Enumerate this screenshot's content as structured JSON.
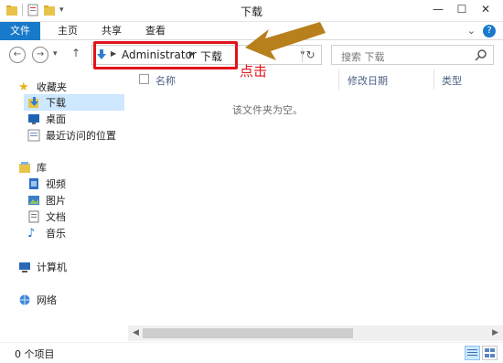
{
  "window": {
    "title": "下载"
  },
  "ribbon": {
    "tabs": [
      "文件",
      "主页",
      "共享",
      "查看"
    ]
  },
  "address": {
    "crumbs": [
      "Administrator",
      "下载"
    ]
  },
  "search": {
    "placeholder": "搜索 下载"
  },
  "annotation": {
    "label": "点击",
    "color": "#e3131b",
    "arrow_color": "#b7801c"
  },
  "nav": {
    "favorites_label": "收藏夹",
    "favorites": [
      "下载",
      "桌面",
      "最近访问的位置"
    ],
    "libraries_label": "库",
    "libraries": [
      "视频",
      "图片",
      "文档",
      "音乐"
    ],
    "computer_label": "计算机",
    "network_label": "网络"
  },
  "columns": [
    "名称",
    "修改日期",
    "类型"
  ],
  "empty_message": "该文件夹为空。",
  "status": {
    "item_count": "0 个项目"
  },
  "colors": {
    "accent": "#1979ca",
    "selection": "#cde8ff"
  }
}
